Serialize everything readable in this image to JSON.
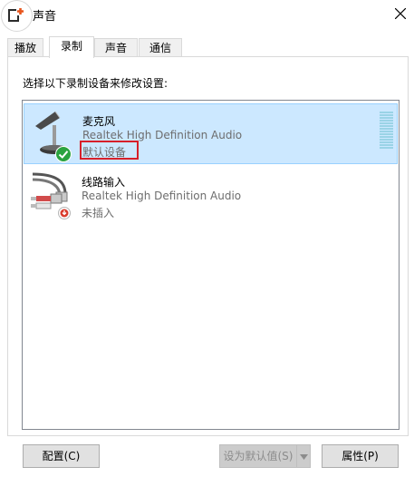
{
  "window": {
    "title": "声音"
  },
  "tabs": [
    {
      "label": "播放"
    },
    {
      "label": "录制"
    },
    {
      "label": "声音"
    },
    {
      "label": "通信"
    }
  ],
  "active_tab": "录制",
  "instruction": "选择以下录制设备来修改设置:",
  "devices": [
    {
      "name": "麦克风",
      "driver": "Realtek High Definition Audio",
      "status": "默认设备",
      "icon": "microphone-icon",
      "badge": "default-check-icon",
      "selected": true
    },
    {
      "name": "线路输入",
      "driver": "Realtek High Definition Audio",
      "status": "未插入",
      "icon": "line-in-icon",
      "badge": "unplugged-icon",
      "selected": false
    }
  ],
  "buttons": {
    "configure": "配置(C)",
    "set_default": "设为默认值(S)",
    "properties": "属性(P)"
  },
  "colors": {
    "selection_bg": "#cce8ff",
    "selection_border": "#99d1ff",
    "highlight_box": "#d7202a",
    "check_badge": "#2aa33f"
  }
}
